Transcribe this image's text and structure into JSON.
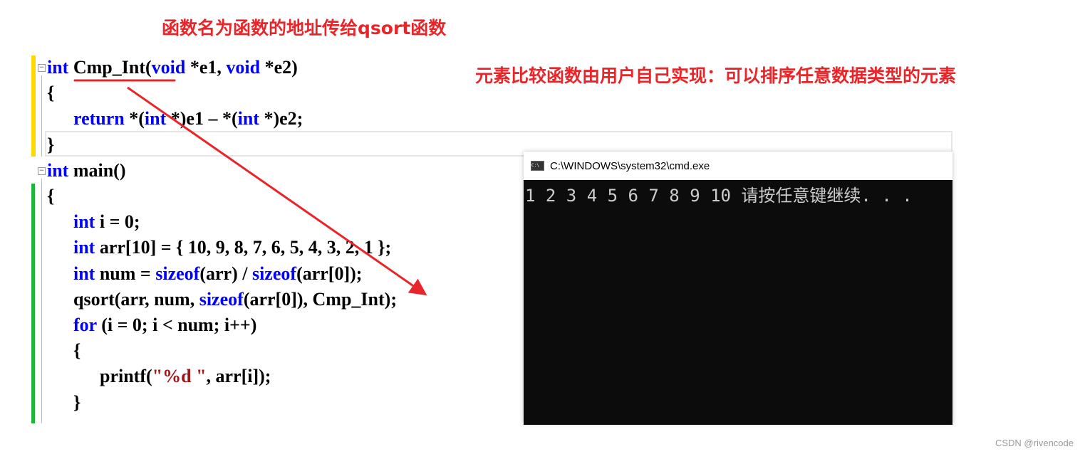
{
  "annotations": {
    "top": "函数名为函数的地址传给qsort函数",
    "right": "元素比较函数由用户自己实现：可以排序任意数据类型的元素"
  },
  "code": [
    {
      "indent": 0,
      "tokens": [
        {
          "t": "kw",
          "v": "int"
        },
        {
          "t": "p",
          "v": " Cmp_Int("
        },
        {
          "t": "kw",
          "v": "void"
        },
        {
          "t": "p",
          "v": " *e1, "
        },
        {
          "t": "kw",
          "v": "void"
        },
        {
          "t": "p",
          "v": " *e2)"
        }
      ]
    },
    {
      "indent": 0,
      "tokens": [
        {
          "t": "p",
          "v": "{"
        }
      ]
    },
    {
      "indent": 1,
      "tokens": [
        {
          "t": "kw",
          "v": "return"
        },
        {
          "t": "p",
          "v": " *("
        },
        {
          "t": "kw",
          "v": "int"
        },
        {
          "t": "p",
          "v": " *)e1 – *("
        },
        {
          "t": "kw",
          "v": "int"
        },
        {
          "t": "p",
          "v": " *)e2;"
        }
      ]
    },
    {
      "indent": 0,
      "tokens": [
        {
          "t": "p",
          "v": "}"
        }
      ]
    },
    {
      "indent": 0,
      "tokens": [
        {
          "t": "kw",
          "v": "int"
        },
        {
          "t": "p",
          "v": " main()"
        }
      ]
    },
    {
      "indent": 0,
      "tokens": [
        {
          "t": "p",
          "v": "{"
        }
      ]
    },
    {
      "indent": 1,
      "tokens": [
        {
          "t": "kw",
          "v": "int"
        },
        {
          "t": "p",
          "v": " i = 0;"
        }
      ]
    },
    {
      "indent": 1,
      "tokens": [
        {
          "t": "kw",
          "v": "int"
        },
        {
          "t": "p",
          "v": " arr[10] = { 10, 9, 8, 7, 6, 5, 4, 3, 2, 1 };"
        }
      ]
    },
    {
      "indent": 1,
      "tokens": [
        {
          "t": "kw",
          "v": "int"
        },
        {
          "t": "p",
          "v": " num = "
        },
        {
          "t": "kw",
          "v": "sizeof"
        },
        {
          "t": "p",
          "v": "(arr) / "
        },
        {
          "t": "kw",
          "v": "sizeof"
        },
        {
          "t": "p",
          "v": "(arr[0]);"
        }
      ]
    },
    {
      "indent": 1,
      "tokens": [
        {
          "t": "p",
          "v": "qsort(arr, num, "
        },
        {
          "t": "kw",
          "v": "sizeof"
        },
        {
          "t": "p",
          "v": "(arr[0]), Cmp_Int);"
        }
      ]
    },
    {
      "indent": 1,
      "tokens": [
        {
          "t": "kw",
          "v": "for"
        },
        {
          "t": "p",
          "v": " (i = 0; i < num; i++)"
        }
      ]
    },
    {
      "indent": 1,
      "tokens": [
        {
          "t": "p",
          "v": "{"
        }
      ]
    },
    {
      "indent": 2,
      "tokens": [
        {
          "t": "p",
          "v": "printf("
        },
        {
          "t": "str",
          "v": "\"%d \""
        },
        {
          "t": "p",
          "v": ", arr[i]);"
        }
      ]
    },
    {
      "indent": 1,
      "tokens": [
        {
          "t": "p",
          "v": "}"
        }
      ]
    }
  ],
  "terminal": {
    "title": "C:\\WINDOWS\\system32\\cmd.exe",
    "icon": "cmd-icon",
    "output": "1 2 3 4 5 6 7 8 9 10 请按任意键继续. . ."
  },
  "footer": "CSDN @rivencode",
  "colors": {
    "annotation": "#e8262a",
    "keyword": "#0000ff",
    "string": "#a31515",
    "changed_saved": "#1fb53a",
    "changed_unsaved": "#ffd800"
  }
}
